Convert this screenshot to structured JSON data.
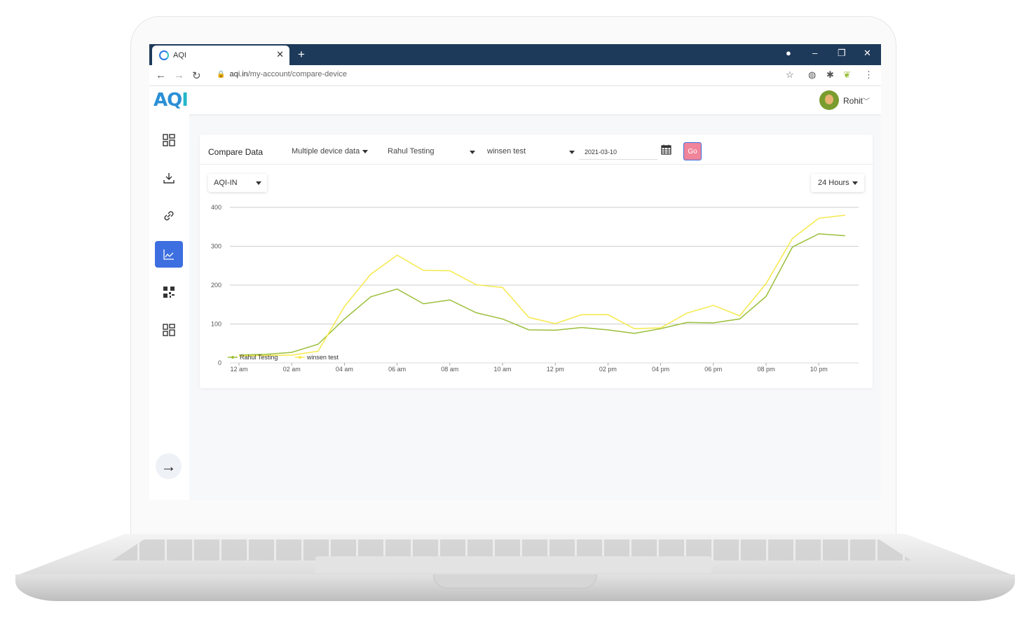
{
  "browser": {
    "tab_title": "AQI",
    "url_host": "aqi.in",
    "url_path": "/my-account/compare-device"
  },
  "app": {
    "logo_text": "AQI",
    "user_name": "Rohit",
    "sidebar": [
      "dashboard-icon",
      "download-icon",
      "link-icon",
      "chart-icon",
      "qr-code-icon",
      "grid-icon"
    ],
    "active_item": "chart-icon"
  },
  "filters": {
    "title": "Compare Data",
    "mode": "Multiple device data",
    "device1": "Rahul Testing",
    "device2": "winsen test",
    "date": "2021-03-10",
    "go_label": "Go"
  },
  "chart_controls": {
    "metric": "AQI-IN",
    "range": "24 Hours"
  },
  "colors": {
    "series1": "#9bbf3a",
    "series2": "#f5e94a",
    "accent": "#3d6fe0",
    "go_button": "#f0849a"
  },
  "chart_data": {
    "type": "line",
    "x": [
      "12 am",
      "01 am",
      "02 am",
      "03 am",
      "04 am",
      "05 am",
      "06 am",
      "07 am",
      "08 am",
      "09 am",
      "10 am",
      "11 am",
      "12 pm",
      "01 pm",
      "02 pm",
      "03 pm",
      "04 pm",
      "05 pm",
      "06 pm",
      "07 pm",
      "08 pm",
      "09 pm",
      "10 pm",
      "11 pm"
    ],
    "tick_labels": [
      "12 am",
      "02 am",
      "04 am",
      "06 am",
      "08 am",
      "10 am",
      "12 pm",
      "02 pm",
      "04 pm",
      "06 pm",
      "08 pm",
      "10 pm"
    ],
    "ylim": [
      0,
      400
    ],
    "yticks": [
      0,
      100,
      200,
      300,
      400
    ],
    "grid": true,
    "legend": "bottom-left",
    "series": [
      {
        "name": "Rahul Testing",
        "values": [
          20,
          22,
          27,
          48,
          113,
          170,
          190,
          152,
          162,
          129,
          113,
          85,
          84,
          91,
          85,
          76,
          88,
          104,
          103,
          113,
          171,
          298,
          332,
          327
        ]
      },
      {
        "name": "winsen test",
        "values": [
          18,
          19,
          20,
          30,
          145,
          228,
          277,
          238,
          237,
          201,
          194,
          117,
          101,
          124,
          124,
          88,
          90,
          128,
          148,
          121,
          204,
          320,
          372,
          380
        ]
      }
    ]
  }
}
